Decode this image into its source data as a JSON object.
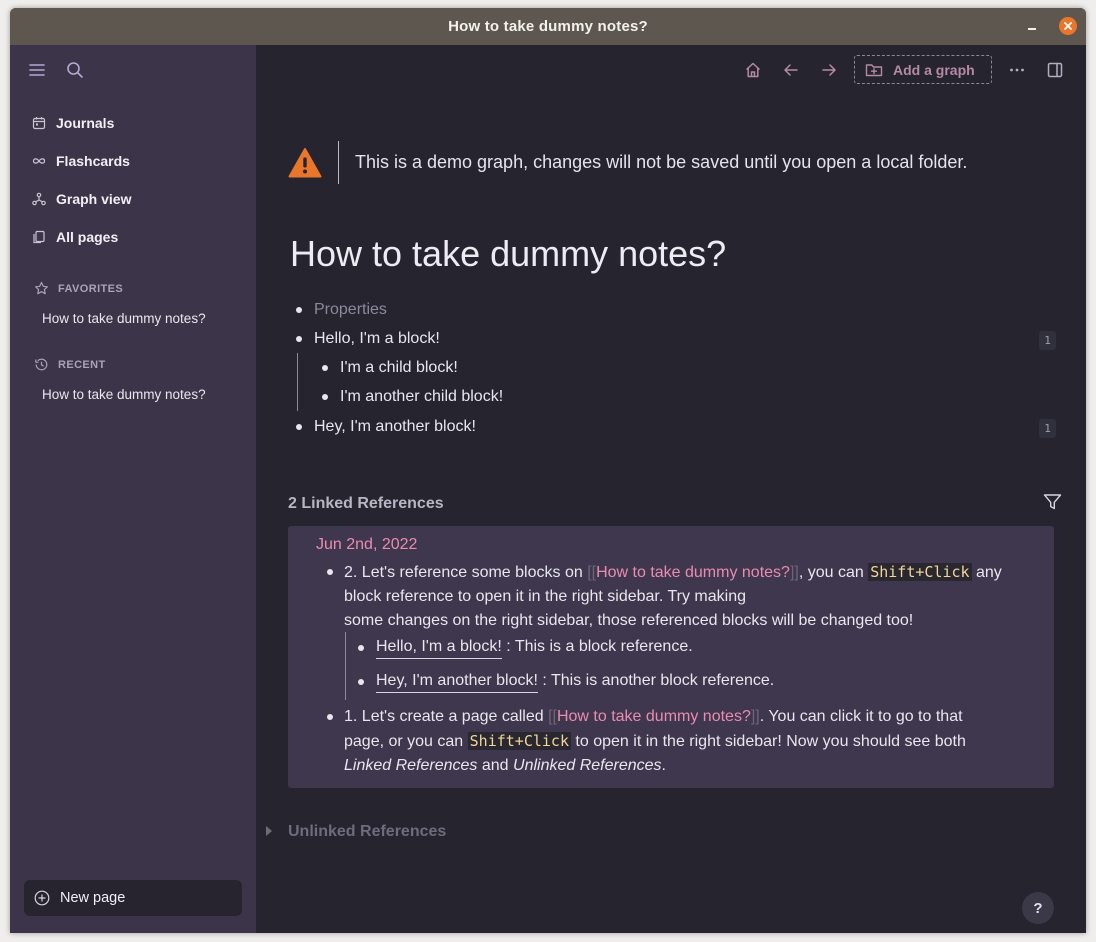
{
  "window": {
    "title": "How to take dummy notes?"
  },
  "sidebar": {
    "nav": [
      {
        "label": "Journals",
        "icon": "calendar-icon"
      },
      {
        "label": "Flashcards",
        "icon": "infinity-icon"
      },
      {
        "label": "Graph view",
        "icon": "graph-icon"
      },
      {
        "label": "All pages",
        "icon": "pages-icon"
      }
    ],
    "favorites": {
      "heading": "FAVORITES",
      "items": [
        "How to take dummy notes?"
      ]
    },
    "recent": {
      "heading": "RECENT",
      "items": [
        "How to take dummy notes?"
      ]
    },
    "new_page": "New page"
  },
  "toolbar": {
    "add_graph": "Add a graph"
  },
  "demo_warning": "This is a demo graph, changes will not be saved until you open a local folder.",
  "page": {
    "title": "How to take dummy notes?",
    "blocks": {
      "properties": "Properties",
      "block1": {
        "text": "Hello, I'm a block!",
        "count": "1"
      },
      "child1": "I'm a child block!",
      "child2": "I'm another child block!",
      "block2": {
        "text": "Hey, I'm another block!",
        "count": "1"
      }
    }
  },
  "linked": {
    "heading": "2 Linked References",
    "date": "Jun 2nd, 2022",
    "item1": {
      "prefix": "2. Let's reference some blocks on ",
      "page_ref": "How to take dummy notes?",
      "mid": ", you can ",
      "kbd": "Shift+Click",
      "after": " any",
      "line2": "block reference to open it in the right sidebar. Try making",
      "line3": "some changes on the right sidebar, those referenced blocks will be changed too!"
    },
    "sub1": {
      "ref": "Hello, I'm a block!",
      "desc": " : This is a block reference."
    },
    "sub2": {
      "ref": "Hey, I'm another block!",
      "desc": " : This is another block reference."
    },
    "item2": {
      "prefix": "1. Let's create a page called ",
      "page_ref": "How to take dummy notes?",
      "after": ". You can click it to go to that",
      "line2a": "page, or you can ",
      "kbd": "Shift+Click",
      "line2b": " to open it in the right sidebar! Now you should see both",
      "italic1": "Linked References",
      "and": " and ",
      "italic2": "Unlinked References",
      "end": "."
    }
  },
  "unlinked": {
    "heading": "Unlinked References"
  },
  "help": "?",
  "colors": {
    "accent": "#ea8cb0",
    "sidebar": "#3c3549",
    "main": "#25242f",
    "warning": "#e9762a"
  }
}
